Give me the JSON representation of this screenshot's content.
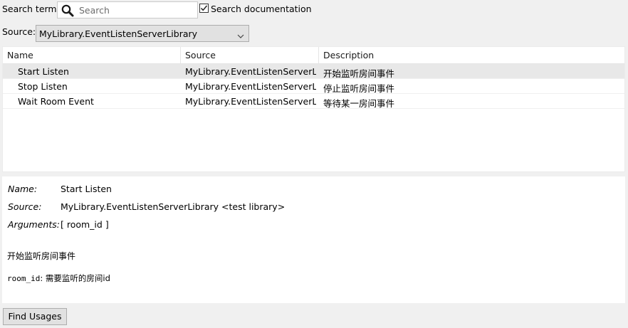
{
  "search": {
    "label": "Search term:",
    "placeholder": "Search",
    "value": "",
    "doc_checkbox_label": "Search documentation",
    "doc_checked": true
  },
  "source": {
    "label": "Source:",
    "selected": "MyLibrary.EventListenServerLibrary"
  },
  "table": {
    "headers": [
      "Name",
      "Source",
      "Description"
    ],
    "rows": [
      {
        "name": "Start Listen",
        "source": "MyLibrary.EventListenServerLi...",
        "description": "开始监听房间事件",
        "selected": true
      },
      {
        "name": "Stop Listen",
        "source": "MyLibrary.EventListenServerLi...",
        "description": "停止监听房间事件",
        "selected": false
      },
      {
        "name": "Wait Room Event",
        "source": "MyLibrary.EventListenServerLi...",
        "description": "等待某一房间事件",
        "selected": false
      }
    ]
  },
  "details": {
    "name_label": "Name:",
    "name_value": "Start Listen",
    "source_label": "Source:",
    "source_value": "MyLibrary.EventListenServerLibrary <test library>",
    "arguments_label": "Arguments:",
    "arguments_value": "[ room_id ]",
    "doc_text": "开始监听房间事件",
    "arg_doc_name": "room_id",
    "arg_doc_text": ": 需要监听的房间id"
  },
  "buttons": {
    "find_usages": "Find Usages"
  },
  "icons": {
    "search": "magnifier-icon",
    "checkbox": "checkmark-icon",
    "dropdown": "chevron-down-icon"
  }
}
